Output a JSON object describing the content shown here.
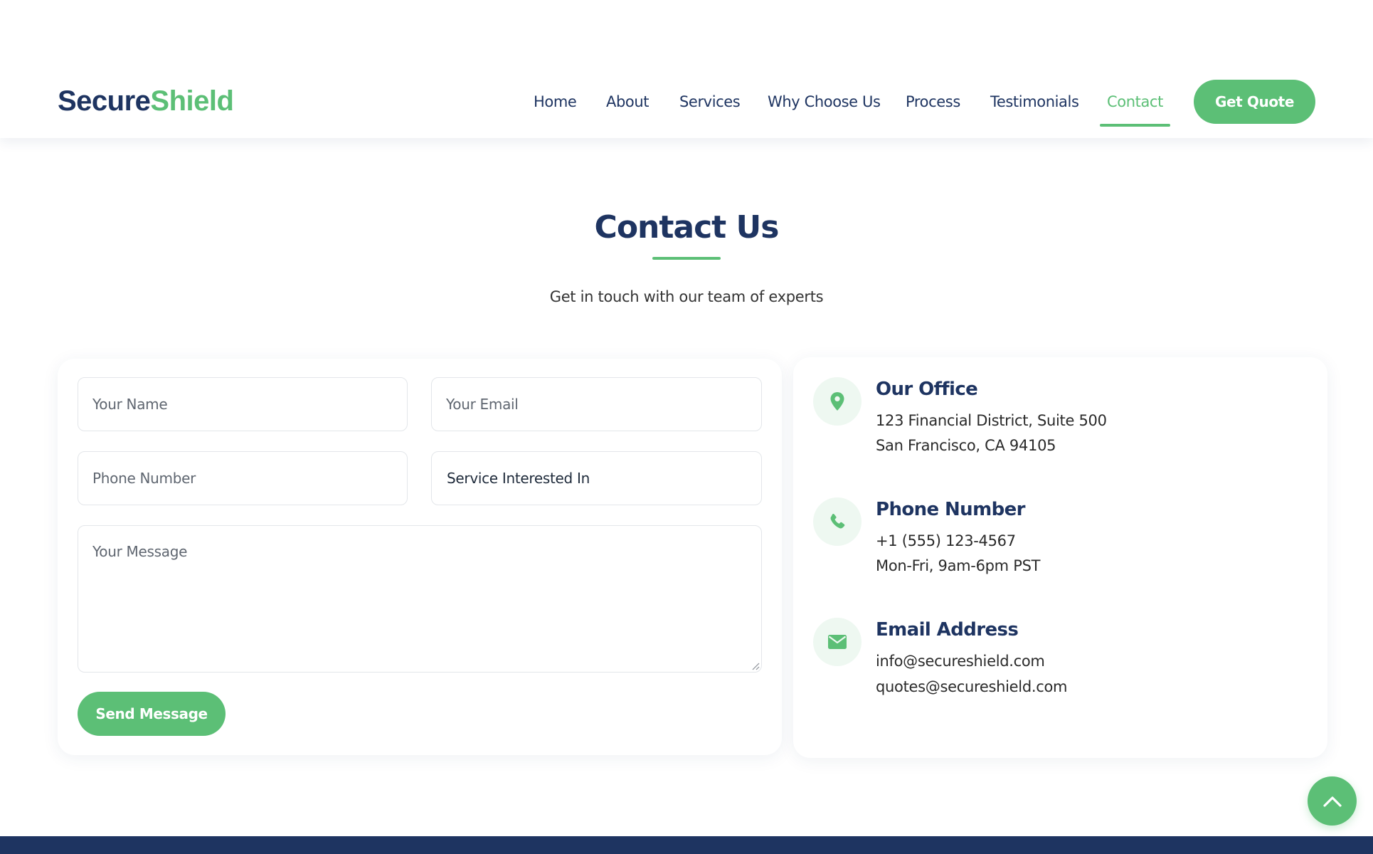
{
  "brand": {
    "part1": "Secure",
    "part2": "Shield"
  },
  "nav": {
    "items": [
      "Home",
      "About",
      "Services",
      "Why Choose Us",
      "Process",
      "Testimonials",
      "Contact"
    ],
    "active": "Contact",
    "cta_label": "Get Quote"
  },
  "contact": {
    "title": "Contact Us",
    "subtitle": "Get in touch with our team of experts"
  },
  "form": {
    "name_placeholder": "Your Name",
    "email_placeholder": "Your Email",
    "phone_placeholder": "Phone Number",
    "service_value": "Service Interested In",
    "message_placeholder": "Your Message",
    "submit_label": "Send Message"
  },
  "info": {
    "office": {
      "title": "Our Office",
      "line1": "123 Financial District, Suite 500",
      "line2": "San Francisco, CA 94105",
      "icon": "map-pin-icon"
    },
    "phone": {
      "title": "Phone Number",
      "line1": "+1 (555) 123-4567",
      "line2": "Mon-Fri, 9am-6pm PST",
      "icon": "phone-icon"
    },
    "email": {
      "title": "Email Address",
      "line1": "info@secureshield.com",
      "line2": "quotes@secureshield.com",
      "icon": "envelope-icon"
    }
  },
  "colors": {
    "navy": "#1e3461",
    "green": "#5cbf76",
    "green_tint": "#eef8f1"
  },
  "back_to_top_icon": "chevron-up-icon"
}
